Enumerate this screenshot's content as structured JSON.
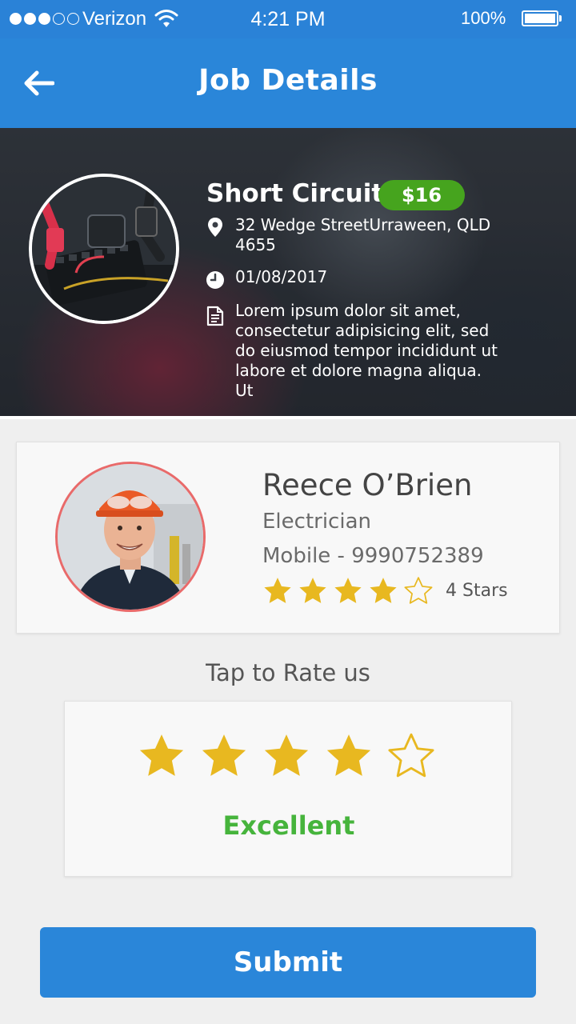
{
  "status_bar": {
    "carrier": "Verizon",
    "time": "4:21 PM",
    "battery": "100%",
    "signal_bars_filled": 3,
    "signal_bars_total": 5
  },
  "header": {
    "title": "Job Details",
    "back_icon": "arrow-left-icon"
  },
  "job": {
    "title": "Short Circuit",
    "price": "$16",
    "address": "32 Wedge StreetUrraween, QLD 4655",
    "date": "01/08/2017",
    "description": "Lorem ipsum dolor sit amet, consectetur adipisicing elit, sed do eiusmod tempor incididunt ut labore et dolore magna aliqua. Ut",
    "icons": [
      "location-pin-icon",
      "clock-icon",
      "document-icon"
    ]
  },
  "worker": {
    "name": "Reece O’Brien",
    "role": "Electrician",
    "mobile": "Mobile - 9990752389",
    "rating": 4,
    "rating_max": 5,
    "rating_label": "4 Stars"
  },
  "rate": {
    "heading": "Tap to Rate us",
    "selected": 4,
    "max": 5,
    "label": "Excellent"
  },
  "submit_label": "Submit",
  "colors": {
    "primary": "#2a86d9",
    "star": "#e8b820",
    "price_badge": "#46a41e",
    "excellent": "#46b43c",
    "avatar_ring": "#e96a6a"
  }
}
